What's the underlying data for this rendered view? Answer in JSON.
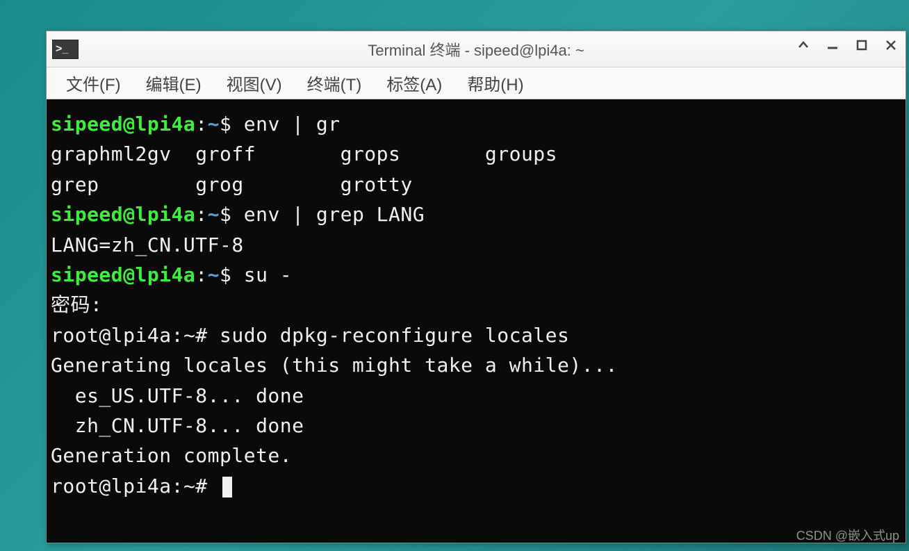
{
  "window": {
    "title": "Terminal 终端 - sipeed@lpi4a: ~"
  },
  "menu": {
    "file": "文件(F)",
    "edit": "编辑(E)",
    "view": "视图(V)",
    "terminal": "终端(T)",
    "tabs": "标签(A)",
    "help": "帮助(H)"
  },
  "prompt": {
    "user_host": "sipeed@lpi4a",
    "sep": ":",
    "path": "~",
    "symbol": "$ ",
    "root_user_host": "root@lpi4a:",
    "root_path": "~",
    "root_symbol": "# "
  },
  "lines": {
    "cmd1": "env | gr",
    "completion1": "graphml2gv  groff       grops       groups",
    "completion2": "grep        grog        grotty",
    "cmd2": "env | grep LANG",
    "out_lang": "LANG=zh_CN.UTF-8",
    "cmd3": "su -",
    "password_label": "密码:",
    "root_cmd1": "sudo dpkg-reconfigure locales",
    "gen1": "Generating locales (this might take a while)...",
    "gen2": "  es_US.UTF-8... done",
    "gen3": "  zh_CN.UTF-8... done",
    "gen4": "Generation complete."
  },
  "watermark": "CSDN @嵌入式up"
}
